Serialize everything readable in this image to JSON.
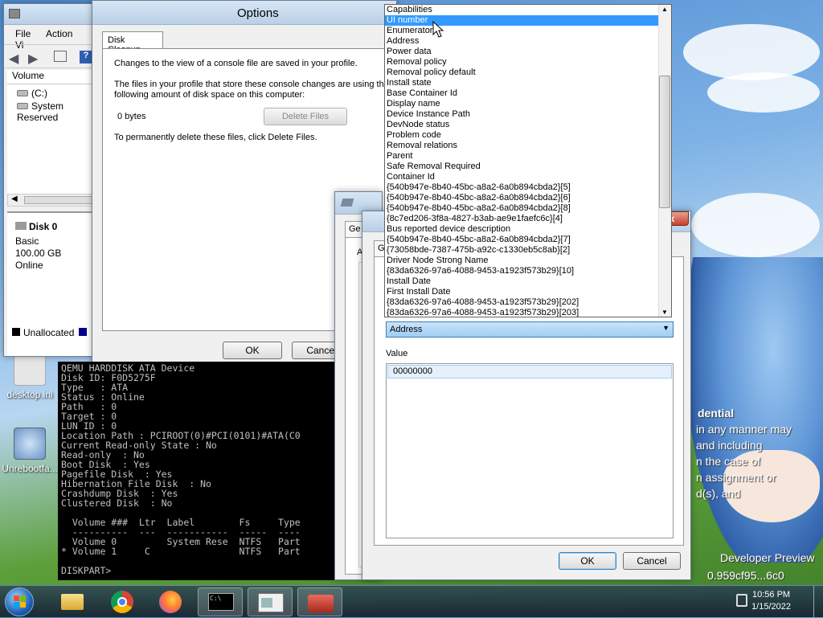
{
  "desktop": {
    "icons": [
      {
        "label": "desktop.ini"
      },
      {
        "label": "Unrebootfa..."
      }
    ],
    "credits": {
      "line1": "dential",
      "line2": "in any manner may",
      "line3": "and including",
      "line4": "n the case of",
      "line5": "n assignment or",
      "line6": "d(s), and",
      "build1": "Developer Preview",
      "build2": "0.959cf95...6c0"
    }
  },
  "disk_mgmt": {
    "menu": [
      "File",
      "Action",
      "Vi"
    ],
    "col_header": "Volume",
    "volumes": [
      "(C:)",
      "System Reserved"
    ],
    "disk": {
      "name": "Disk 0",
      "type": "Basic",
      "size": "100.00 GB",
      "status": "Online"
    },
    "legend": "Unallocated"
  },
  "options": {
    "title": "Options",
    "tab": "Disk Cleanup",
    "text1": "Changes to the view of a console file are saved in your profile.",
    "text2": "The files in your profile that store these console changes are using the",
    "text3": "following amount of disk space on this computer:",
    "bytes": "0 bytes",
    "delete_label": "Delete Files",
    "text4": "To permanently delete these files, click Delete Files.",
    "ok": "OK",
    "cancel": "Cancel"
  },
  "props_back": {
    "tab1": "Ge",
    "label": "A"
  },
  "props_front": {
    "tab_g": "G",
    "selected": "Address",
    "value_label": "Value",
    "value": "00000000",
    "ok": "OK",
    "cancel": "Cancel",
    "close": "x"
  },
  "dropdown": {
    "items": [
      "Capabilities",
      "UI number",
      "Enumerator",
      "Address",
      "Power data",
      "Removal policy",
      "Removal policy default",
      "Install state",
      "Base Container Id",
      "Display name",
      "Device Instance Path",
      "DevNode status",
      "Problem code",
      "Removal relations",
      "Parent",
      "Safe Removal Required",
      "Container Id",
      "{540b947e-8b40-45bc-a8a2-6a0b894cbda2}[5]",
      "{540b947e-8b40-45bc-a8a2-6a0b894cbda2}[6]",
      "{540b947e-8b40-45bc-a8a2-6a0b894cbda2}[8]",
      "{8c7ed206-3f8a-4827-b3ab-ae9e1faefc6c}[4]",
      "Bus reported device description",
      "{540b947e-8b40-45bc-a8a2-6a0b894cbda2}[7]",
      "{73058bde-7387-475b-a92c-c1330eb5c8ab}[2]",
      "Driver Node Strong Name",
      "{83da6326-97a6-4088-9453-a1923f573b29}[10]",
      "Install Date",
      "First Install Date",
      "{83da6326-97a6-4088-9453-a1923f573b29}[202]",
      "{83da6326-97a6-4088-9453-a1923f573b29}[203]"
    ],
    "selected_index": 1
  },
  "console": {
    "lines": [
      "QEMU HARDDISK ATA Device",
      "Disk ID: F0D5275F",
      "Type   : ATA",
      "Status : Online",
      "Path   : 0",
      "Target : 0",
      "LUN ID : 0",
      "Location Path : PCIROOT(0)#PCI(0101)#ATA(C0",
      "Current Read-only State : No",
      "Read-only  : No",
      "Boot Disk  : Yes",
      "Pagefile Disk  : Yes",
      "Hibernation File Disk  : No",
      "Crashdump Disk  : Yes",
      "Clustered Disk  : No",
      "",
      "  Volume ###  Ltr  Label        Fs     Type",
      "  ----------  ---  -----------  -----  ----",
      "  Volume 0         System Rese  NTFS   Part",
      "* Volume 1     C                NTFS   Part",
      "",
      "DISKPART>"
    ]
  },
  "taskbar": {
    "time": "10:56 PM",
    "date": "1/15/2022"
  },
  "colors": {
    "selection": "#3399ff",
    "console_bg": "#000000",
    "taskbar": "#1e2c44"
  }
}
